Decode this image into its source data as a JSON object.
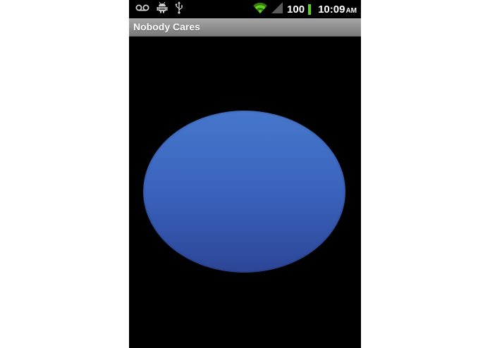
{
  "status_bar": {
    "icons_left": [
      "voicemail-icon",
      "android-debug-icon",
      "usb-icon"
    ],
    "icons_right": [
      "wifi-icon",
      "cell-signal-icon"
    ],
    "battery_level": "100",
    "time": "10:09",
    "ampm": "AM"
  },
  "app": {
    "title": "Nobody Cares"
  },
  "colors": {
    "ellipse_top": "#4677cc",
    "ellipse_bottom": "#2c4596",
    "wifi": "#5fd41f",
    "battery": "#5fd41f"
  }
}
